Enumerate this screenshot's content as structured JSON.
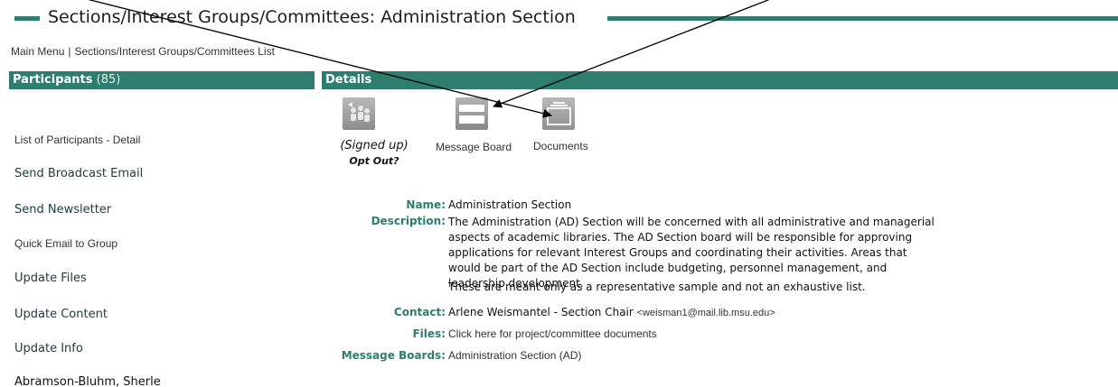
{
  "page": {
    "title": "Sections/Interest Groups/Committees: Administration Section"
  },
  "breadcrumb": {
    "items": [
      "Main Menu",
      "Sections/Interest Groups/Committees List"
    ],
    "separator": "|"
  },
  "participants_panel": {
    "header_label": "Participants",
    "header_count": "(85)",
    "menu": [
      "List of Participants - Detail",
      "Send Broadcast Email",
      "Send Newsletter",
      "Quick Email to Group",
      "Update Files",
      "Update Content",
      "Update Info",
      "Abramson-Bluhm, Sherle"
    ]
  },
  "details_panel": {
    "header_label": "Details",
    "icons": {
      "signup_status": "(Signed up)",
      "opt_out": "Opt Out?",
      "message_board": "Message Board",
      "documents": "Documents"
    },
    "fields": {
      "name_label": "Name:",
      "name_value": "Administration Section",
      "description_label": "Description:",
      "description_p1": "The Administration (AD) Section will be concerned with all administrative and managerial aspects of academic libraries. The AD Section board will be responsible for approving applications for relevant Interest Groups and coordinating their activities. Areas that would be part of the AD Section include budgeting, personnel management, and leadership development.",
      "description_p2": "These are meant only as a representative sample and not an exhaustive list.",
      "contact_label": "Contact:",
      "contact_name": "Arlene Weismantel - Section Chair",
      "contact_email": "<weisman1@mail.lib.msu.edu>",
      "files_label": "Files:",
      "files_value": "Click here for project/committee documents",
      "message_boards_label": "Message Boards:",
      "message_boards_value": "Administration Section (AD)"
    }
  },
  "colors": {
    "accent": "#2e7d6e",
    "text": "#222222"
  }
}
